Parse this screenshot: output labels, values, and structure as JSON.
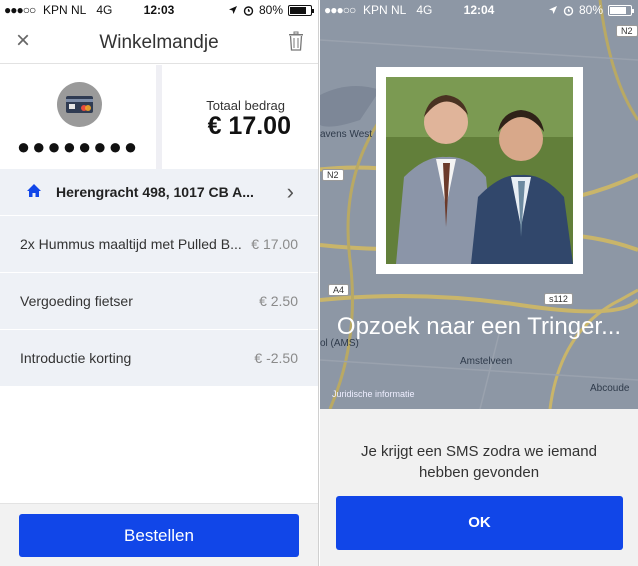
{
  "colors": {
    "accent": "#1146e8",
    "item_bg": "#eef1f6",
    "price_gray": "#8a8a8a"
  },
  "left_screen": {
    "status": {
      "signal": "●●●○○",
      "carrier": "KPN NL",
      "network": "4G",
      "time": "12:03",
      "battery": "80%",
      "battery_level": 0.8
    },
    "nav": {
      "title": "Winkelmandje",
      "close_icon": "close-icon",
      "trash_icon": "trash-icon"
    },
    "payment": {
      "card_icon": "credit-card-icon",
      "card_mask": "●●●●●●●●",
      "total_label": "Totaal bedrag",
      "total_value": "€ 17.00"
    },
    "address": {
      "icon": "home-icon",
      "text": "Herengracht 498, 1017 CB A...",
      "chevron_icon": "chevron-right-icon"
    },
    "items": [
      {
        "name": "2x Hummus maaltijd met Pulled B...",
        "price": "€ 17.00"
      },
      {
        "name": "Vergoeding fietser",
        "price": "€ 2.50"
      },
      {
        "name": "Introductie korting",
        "price": "€ -2.50"
      }
    ],
    "order_button": "Bestellen"
  },
  "right_screen": {
    "status": {
      "signal": "●●●○○",
      "carrier": "KPN NL",
      "network": "4G",
      "time": "12:04",
      "battery": "80%",
      "battery_level": 0.8
    },
    "map": {
      "labels": [
        "avens West",
        "Amstelveen",
        "Abcoude",
        "ol (AMS)"
      ],
      "road_badges": [
        "N2",
        "N2",
        "A4",
        "s112"
      ],
      "attribution": "Juridische informatie"
    },
    "searching_text": "Opzoek naar een Tringer...",
    "sms_message": "Je krijgt een SMS zodra we iemand hebben gevonden",
    "ok_button": "OK"
  }
}
